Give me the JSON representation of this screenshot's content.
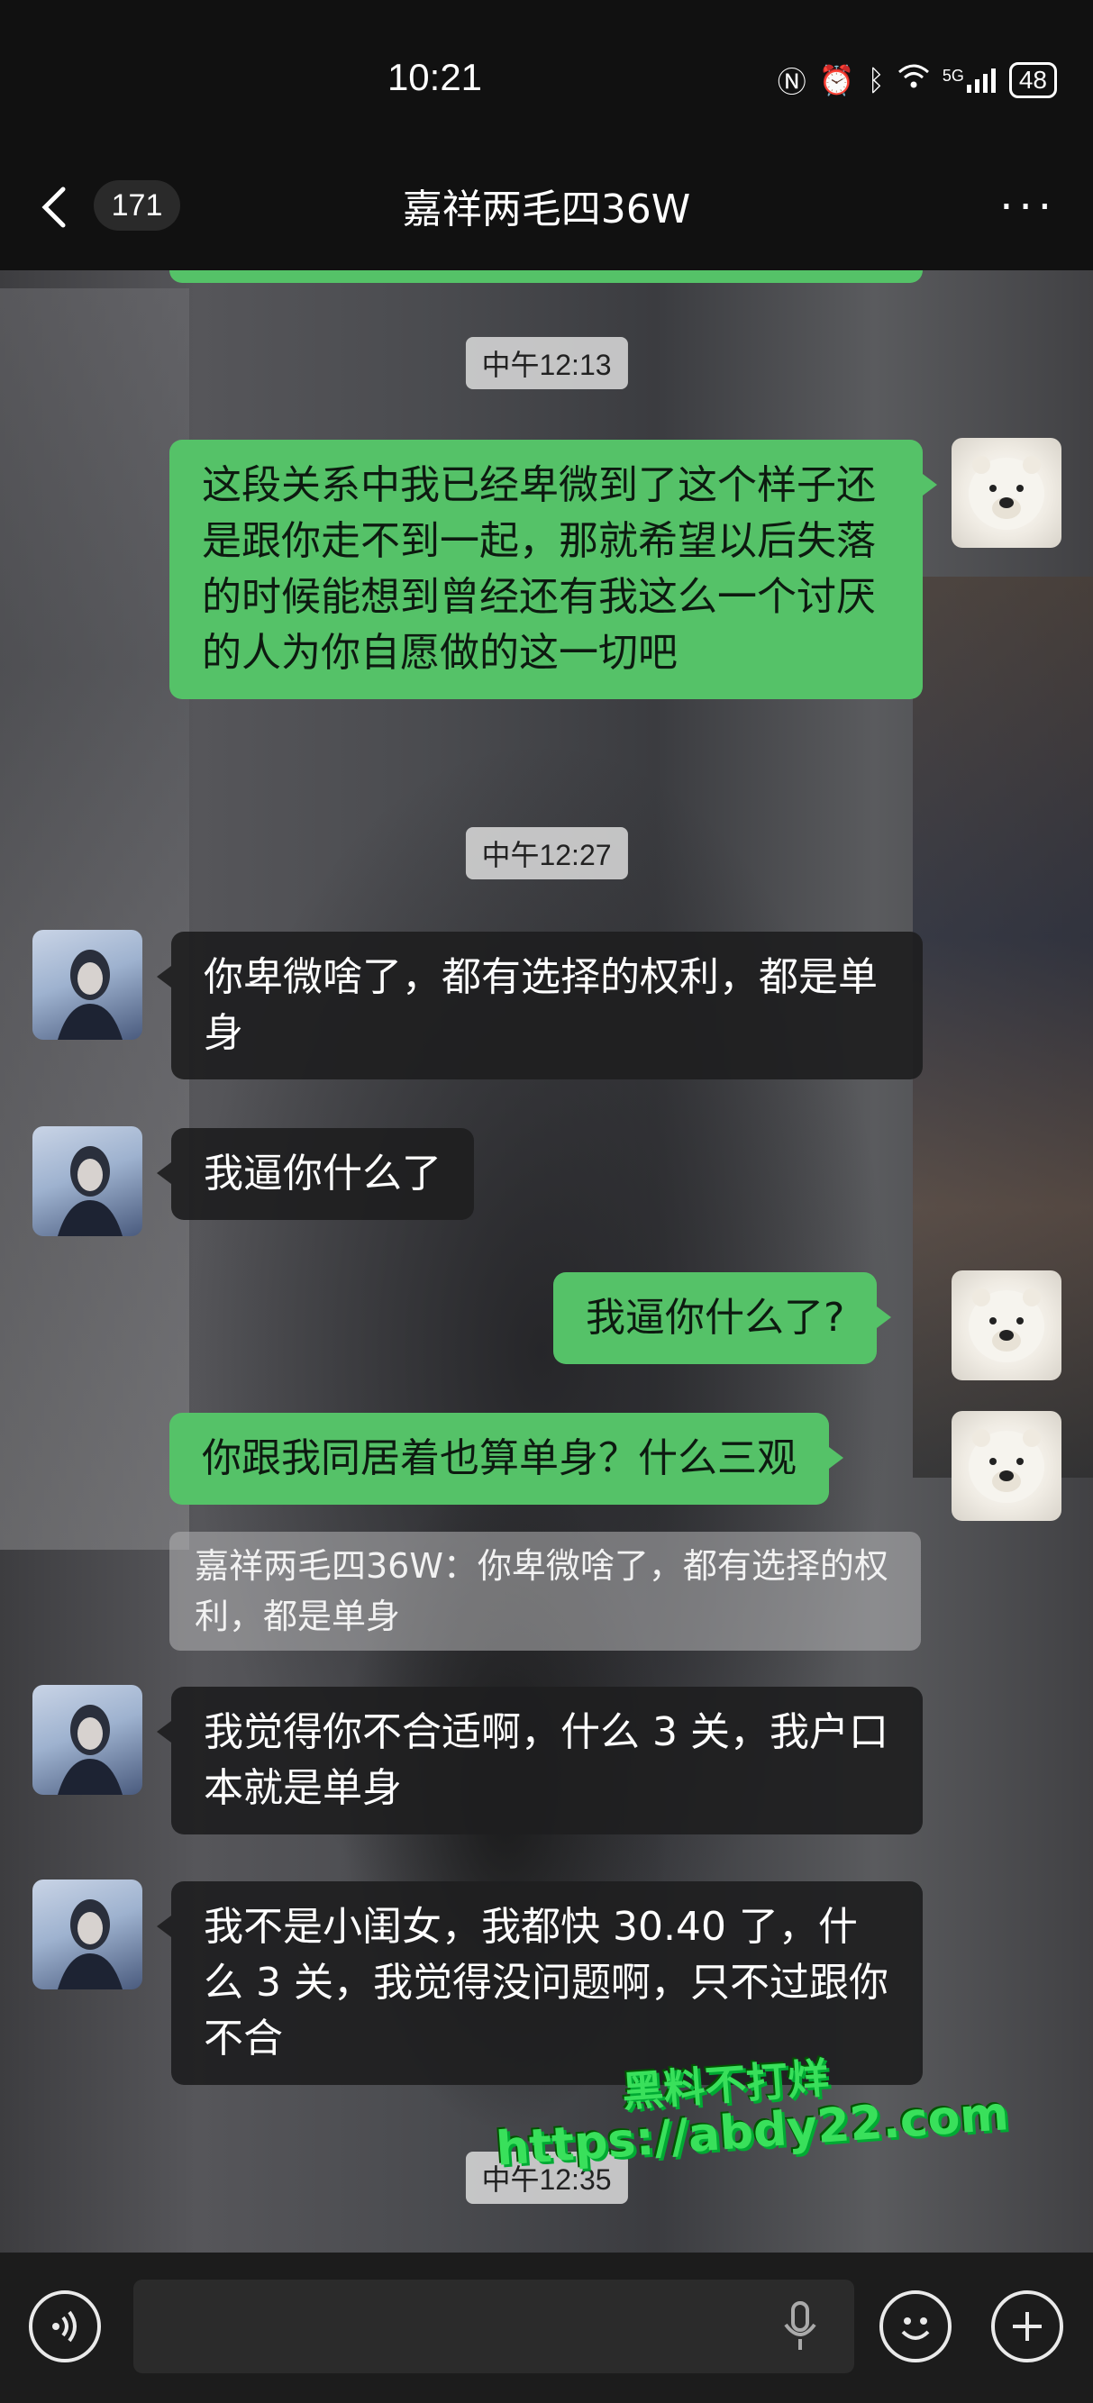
{
  "status_bar": {
    "time": "10:21",
    "battery": "48",
    "signal": "5G"
  },
  "header": {
    "unread_count": "171",
    "title": "嘉祥两毛四36W",
    "more": "···"
  },
  "messages": [
    {
      "type": "timestamp",
      "text": "中午12:13"
    },
    {
      "type": "sent",
      "text": "这段关系中我已经卑微到了这个样子还是跟你走不到一起，那就希望以后失落的时候能想到曾经还有我这么一个讨厌的人为你自愿做的这一切吧"
    },
    {
      "type": "timestamp",
      "text": "中午12:27"
    },
    {
      "type": "received",
      "text": "你卑微啥了，都有选择的权利，都是单身"
    },
    {
      "type": "received",
      "text": "我逼你什么了"
    },
    {
      "type": "sent",
      "text": "我逼你什么了?"
    },
    {
      "type": "sent",
      "text": "你跟我同居着也算单身？什么三观"
    },
    {
      "type": "quote",
      "text": "嘉祥两毛四36W：你卑微啥了，都有选择的权利，都是单身"
    },
    {
      "type": "received",
      "text": "我觉得你不合适啊，什么 3 关，我户口本就是单身"
    },
    {
      "type": "received",
      "text": "我不是小闺女，我都快 30.40 了，什么 3 关，我觉得没问题啊，只不过跟你不合"
    },
    {
      "type": "timestamp",
      "text": "中午12:35"
    }
  ],
  "watermark": {
    "line1": "黑料不打烊",
    "line2": "https://abdy22.com"
  },
  "colors": {
    "sent_bubble": "#55c268",
    "received_bubble": "#1e1e20",
    "background": "#111111"
  }
}
